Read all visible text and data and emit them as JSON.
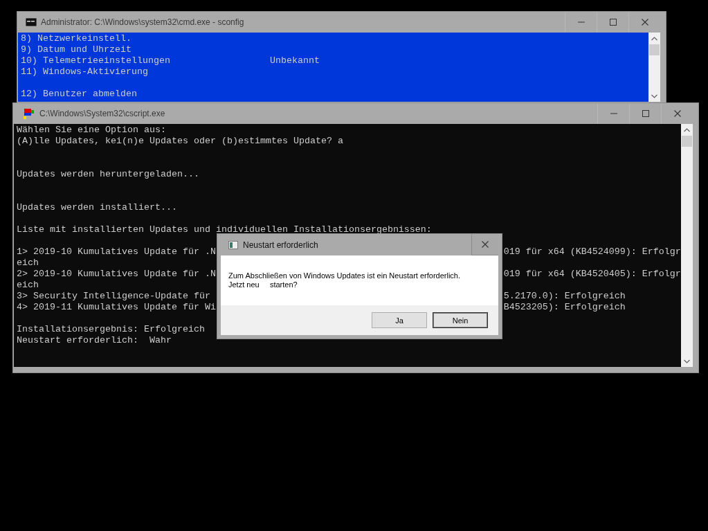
{
  "windows": [
    {
      "kind": "cmd",
      "active": false,
      "title": "Administrator: C:\\Windows\\system32\\cmd.exe - sconfig",
      "lines": [
        {
          "kind": "text",
          "text": "8) Netzwerkeinstell."
        },
        {
          "kind": "text",
          "text": "9) Datum und Uhrzeit"
        },
        {
          "kind": "text",
          "text": "10) Telemetrieeinstellungen                  Unbekannt"
        },
        {
          "kind": "text",
          "text": "11) Windows-Aktivierung"
        },
        {
          "kind": "blank"
        },
        {
          "kind": "text",
          "text": "12) Benutzer abmelden"
        }
      ]
    },
    {
      "kind": "cscript",
      "active": false,
      "title": "C:\\Windows\\System32\\cscript.exe",
      "lines": [
        {
          "kind": "text",
          "text": "Wählen Sie eine Option aus:"
        },
        {
          "kind": "text",
          "text": "(A)lle Updates, kei(n)e Updates oder (b)estimmtes Update? a"
        },
        {
          "kind": "blank"
        },
        {
          "kind": "blank"
        },
        {
          "kind": "text",
          "text": "Updates werden heruntergeladen..."
        },
        {
          "kind": "blank"
        },
        {
          "kind": "blank"
        },
        {
          "kind": "text",
          "text": "Updates werden installiert..."
        },
        {
          "kind": "blank"
        },
        {
          "kind": "text",
          "text": "Liste mit installierten Updates und individuellen Installationsergebnissen:"
        },
        {
          "kind": "blank"
        },
        {
          "kind": "text",
          "text": "1> 2019-10 Kumulatives Update für .N",
          "tail": "019 für x64 (KB4524099): Erfolgr"
        },
        {
          "kind": "text",
          "text": "eich"
        },
        {
          "kind": "text",
          "text": "2> 2019-10 Kumulatives Update für .N",
          "tail": "019 für x64 (KB4520405): Erfolgr"
        },
        {
          "kind": "text",
          "text": "eich"
        },
        {
          "kind": "text",
          "text": "3> Security Intelligence-Update für",
          "tail": "5.2170.0): Erfolgreich"
        },
        {
          "kind": "text",
          "text": "4> 2019-11 Kumulatives Update für Wi",
          "tail": "B4523205): Erfolgreich"
        },
        {
          "kind": "blank"
        },
        {
          "kind": "text",
          "text": "Installationsergebnis: Erfolgreich"
        },
        {
          "kind": "text",
          "text": "Neustart erforderlich:  Wahr"
        }
      ]
    }
  ],
  "dialog": {
    "title": "Neustart erforderlich",
    "message": "Zum Abschließen von Windows Updates ist ein Neustart erforderlich.\nJetzt neu     starten?",
    "buttons": [
      {
        "label": "Ja",
        "default": false
      },
      {
        "label": "Nein",
        "default": true
      }
    ]
  }
}
